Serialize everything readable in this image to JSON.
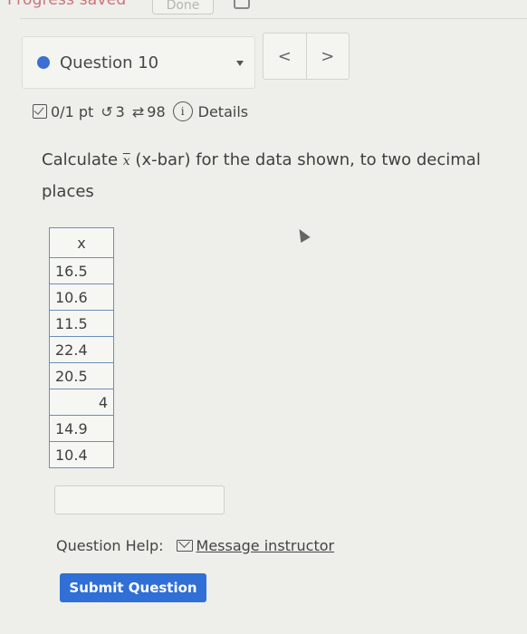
{
  "header": {
    "progress_text": "Progress saved",
    "done_label": "Done"
  },
  "question_nav": {
    "current_label": "Question 10",
    "prev_label": "<",
    "next_label": ">",
    "colors": {
      "status_dot": "#3b6fd1"
    }
  },
  "meta": {
    "score": "0/1 pt",
    "attempts": "3",
    "submissions": "98",
    "details_label": "Details",
    "icons": [
      "checkbox-icon",
      "retry-icon",
      "submissions-icon",
      "info-icon"
    ]
  },
  "prompt": {
    "before": "Calculate ",
    "symbol": "x",
    "after": " (x-bar) for the data shown, to two decimal places"
  },
  "table": {
    "header": "x",
    "rows": [
      "16.5",
      "10.6",
      "11.5",
      "22.4",
      "20.5",
      "4",
      "14.9",
      "10.4"
    ]
  },
  "answer": {
    "value": "",
    "placeholder": ""
  },
  "help": {
    "label": "Question Help:",
    "message_link": "Message instructor"
  },
  "submit": {
    "label": "Submit Question",
    "color": "#2f6fd6"
  }
}
